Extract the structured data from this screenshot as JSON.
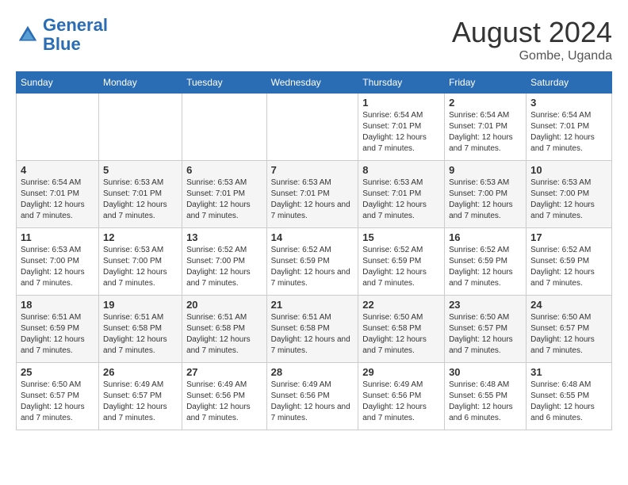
{
  "header": {
    "logo_line1": "General",
    "logo_line2": "Blue",
    "month_year": "August 2024",
    "location": "Gombe, Uganda"
  },
  "weekdays": [
    "Sunday",
    "Monday",
    "Tuesday",
    "Wednesday",
    "Thursday",
    "Friday",
    "Saturday"
  ],
  "weeks": [
    [
      {
        "day": "",
        "sunrise": "",
        "sunset": "",
        "daylight": ""
      },
      {
        "day": "",
        "sunrise": "",
        "sunset": "",
        "daylight": ""
      },
      {
        "day": "",
        "sunrise": "",
        "sunset": "",
        "daylight": ""
      },
      {
        "day": "",
        "sunrise": "",
        "sunset": "",
        "daylight": ""
      },
      {
        "day": "1",
        "sunrise": "Sunrise: 6:54 AM",
        "sunset": "Sunset: 7:01 PM",
        "daylight": "Daylight: 12 hours and 7 minutes."
      },
      {
        "day": "2",
        "sunrise": "Sunrise: 6:54 AM",
        "sunset": "Sunset: 7:01 PM",
        "daylight": "Daylight: 12 hours and 7 minutes."
      },
      {
        "day": "3",
        "sunrise": "Sunrise: 6:54 AM",
        "sunset": "Sunset: 7:01 PM",
        "daylight": "Daylight: 12 hours and 7 minutes."
      }
    ],
    [
      {
        "day": "4",
        "sunrise": "Sunrise: 6:54 AM",
        "sunset": "Sunset: 7:01 PM",
        "daylight": "Daylight: 12 hours and 7 minutes."
      },
      {
        "day": "5",
        "sunrise": "Sunrise: 6:53 AM",
        "sunset": "Sunset: 7:01 PM",
        "daylight": "Daylight: 12 hours and 7 minutes."
      },
      {
        "day": "6",
        "sunrise": "Sunrise: 6:53 AM",
        "sunset": "Sunset: 7:01 PM",
        "daylight": "Daylight: 12 hours and 7 minutes."
      },
      {
        "day": "7",
        "sunrise": "Sunrise: 6:53 AM",
        "sunset": "Sunset: 7:01 PM",
        "daylight": "Daylight: 12 hours and 7 minutes."
      },
      {
        "day": "8",
        "sunrise": "Sunrise: 6:53 AM",
        "sunset": "Sunset: 7:01 PM",
        "daylight": "Daylight: 12 hours and 7 minutes."
      },
      {
        "day": "9",
        "sunrise": "Sunrise: 6:53 AM",
        "sunset": "Sunset: 7:00 PM",
        "daylight": "Daylight: 12 hours and 7 minutes."
      },
      {
        "day": "10",
        "sunrise": "Sunrise: 6:53 AM",
        "sunset": "Sunset: 7:00 PM",
        "daylight": "Daylight: 12 hours and 7 minutes."
      }
    ],
    [
      {
        "day": "11",
        "sunrise": "Sunrise: 6:53 AM",
        "sunset": "Sunset: 7:00 PM",
        "daylight": "Daylight: 12 hours and 7 minutes."
      },
      {
        "day": "12",
        "sunrise": "Sunrise: 6:53 AM",
        "sunset": "Sunset: 7:00 PM",
        "daylight": "Daylight: 12 hours and 7 minutes."
      },
      {
        "day": "13",
        "sunrise": "Sunrise: 6:52 AM",
        "sunset": "Sunset: 7:00 PM",
        "daylight": "Daylight: 12 hours and 7 minutes."
      },
      {
        "day": "14",
        "sunrise": "Sunrise: 6:52 AM",
        "sunset": "Sunset: 6:59 PM",
        "daylight": "Daylight: 12 hours and 7 minutes."
      },
      {
        "day": "15",
        "sunrise": "Sunrise: 6:52 AM",
        "sunset": "Sunset: 6:59 PM",
        "daylight": "Daylight: 12 hours and 7 minutes."
      },
      {
        "day": "16",
        "sunrise": "Sunrise: 6:52 AM",
        "sunset": "Sunset: 6:59 PM",
        "daylight": "Daylight: 12 hours and 7 minutes."
      },
      {
        "day": "17",
        "sunrise": "Sunrise: 6:52 AM",
        "sunset": "Sunset: 6:59 PM",
        "daylight": "Daylight: 12 hours and 7 minutes."
      }
    ],
    [
      {
        "day": "18",
        "sunrise": "Sunrise: 6:51 AM",
        "sunset": "Sunset: 6:59 PM",
        "daylight": "Daylight: 12 hours and 7 minutes."
      },
      {
        "day": "19",
        "sunrise": "Sunrise: 6:51 AM",
        "sunset": "Sunset: 6:58 PM",
        "daylight": "Daylight: 12 hours and 7 minutes."
      },
      {
        "day": "20",
        "sunrise": "Sunrise: 6:51 AM",
        "sunset": "Sunset: 6:58 PM",
        "daylight": "Daylight: 12 hours and 7 minutes."
      },
      {
        "day": "21",
        "sunrise": "Sunrise: 6:51 AM",
        "sunset": "Sunset: 6:58 PM",
        "daylight": "Daylight: 12 hours and 7 minutes."
      },
      {
        "day": "22",
        "sunrise": "Sunrise: 6:50 AM",
        "sunset": "Sunset: 6:58 PM",
        "daylight": "Daylight: 12 hours and 7 minutes."
      },
      {
        "day": "23",
        "sunrise": "Sunrise: 6:50 AM",
        "sunset": "Sunset: 6:57 PM",
        "daylight": "Daylight: 12 hours and 7 minutes."
      },
      {
        "day": "24",
        "sunrise": "Sunrise: 6:50 AM",
        "sunset": "Sunset: 6:57 PM",
        "daylight": "Daylight: 12 hours and 7 minutes."
      }
    ],
    [
      {
        "day": "25",
        "sunrise": "Sunrise: 6:50 AM",
        "sunset": "Sunset: 6:57 PM",
        "daylight": "Daylight: 12 hours and 7 minutes."
      },
      {
        "day": "26",
        "sunrise": "Sunrise: 6:49 AM",
        "sunset": "Sunset: 6:57 PM",
        "daylight": "Daylight: 12 hours and 7 minutes."
      },
      {
        "day": "27",
        "sunrise": "Sunrise: 6:49 AM",
        "sunset": "Sunset: 6:56 PM",
        "daylight": "Daylight: 12 hours and 7 minutes."
      },
      {
        "day": "28",
        "sunrise": "Sunrise: 6:49 AM",
        "sunset": "Sunset: 6:56 PM",
        "daylight": "Daylight: 12 hours and 7 minutes."
      },
      {
        "day": "29",
        "sunrise": "Sunrise: 6:49 AM",
        "sunset": "Sunset: 6:56 PM",
        "daylight": "Daylight: 12 hours and 7 minutes."
      },
      {
        "day": "30",
        "sunrise": "Sunrise: 6:48 AM",
        "sunset": "Sunset: 6:55 PM",
        "daylight": "Daylight: 12 hours and 6 minutes."
      },
      {
        "day": "31",
        "sunrise": "Sunrise: 6:48 AM",
        "sunset": "Sunset: 6:55 PM",
        "daylight": "Daylight: 12 hours and 6 minutes."
      }
    ]
  ]
}
